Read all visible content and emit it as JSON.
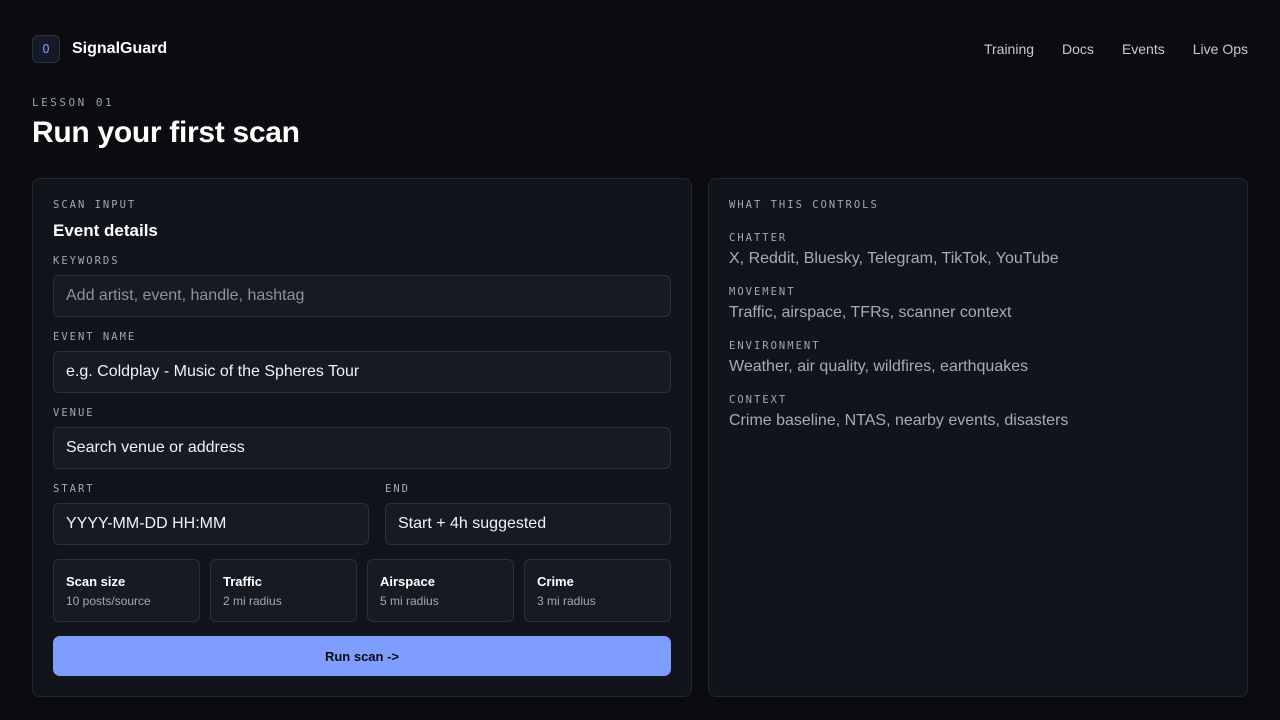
{
  "brand": {
    "logo_glyph": "O",
    "name": "SignalGuard",
    "accent": "#7f9cff"
  },
  "nav": [
    "Training",
    "Docs",
    "Events",
    "Live Ops"
  ],
  "lesson": {
    "eyebrow": "LESSON 01",
    "title": "Run your first scan"
  },
  "scan_input": {
    "eyebrow": "SCAN INPUT",
    "title": "Event details",
    "keywords": {
      "label": "KEYWORDS",
      "placeholder": "Add artist, event, handle, hashtag"
    },
    "event_name": {
      "label": "EVENT NAME",
      "value": "e.g. Coldplay - Music of the Spheres Tour"
    },
    "venue": {
      "label": "VENUE",
      "value": "Search venue or address"
    },
    "start": {
      "label": "START",
      "value": "YYYY-MM-DD HH:MM"
    },
    "end": {
      "label": "END",
      "value": "Start + 4h suggested"
    },
    "options": [
      {
        "title": "Scan size",
        "sub": "10 posts/source"
      },
      {
        "title": "Traffic",
        "sub": "2 mi radius"
      },
      {
        "title": "Airspace",
        "sub": "5 mi radius"
      },
      {
        "title": "Crime",
        "sub": "3 mi radius"
      }
    ],
    "run_label": "Run scan ->"
  },
  "controls": {
    "eyebrow": "WHAT THIS CONTROLS",
    "items": [
      {
        "label": "CHATTER",
        "desc": "X, Reddit, Bluesky, Telegram, TikTok, YouTube"
      },
      {
        "label": "MOVEMENT",
        "desc": "Traffic, airspace, TFRs, scanner context"
      },
      {
        "label": "ENVIRONMENT",
        "desc": "Weather, air quality, wildfires, earthquakes"
      },
      {
        "label": "CONTEXT",
        "desc": "Crime baseline, NTAS, nearby events, disasters"
      }
    ]
  }
}
